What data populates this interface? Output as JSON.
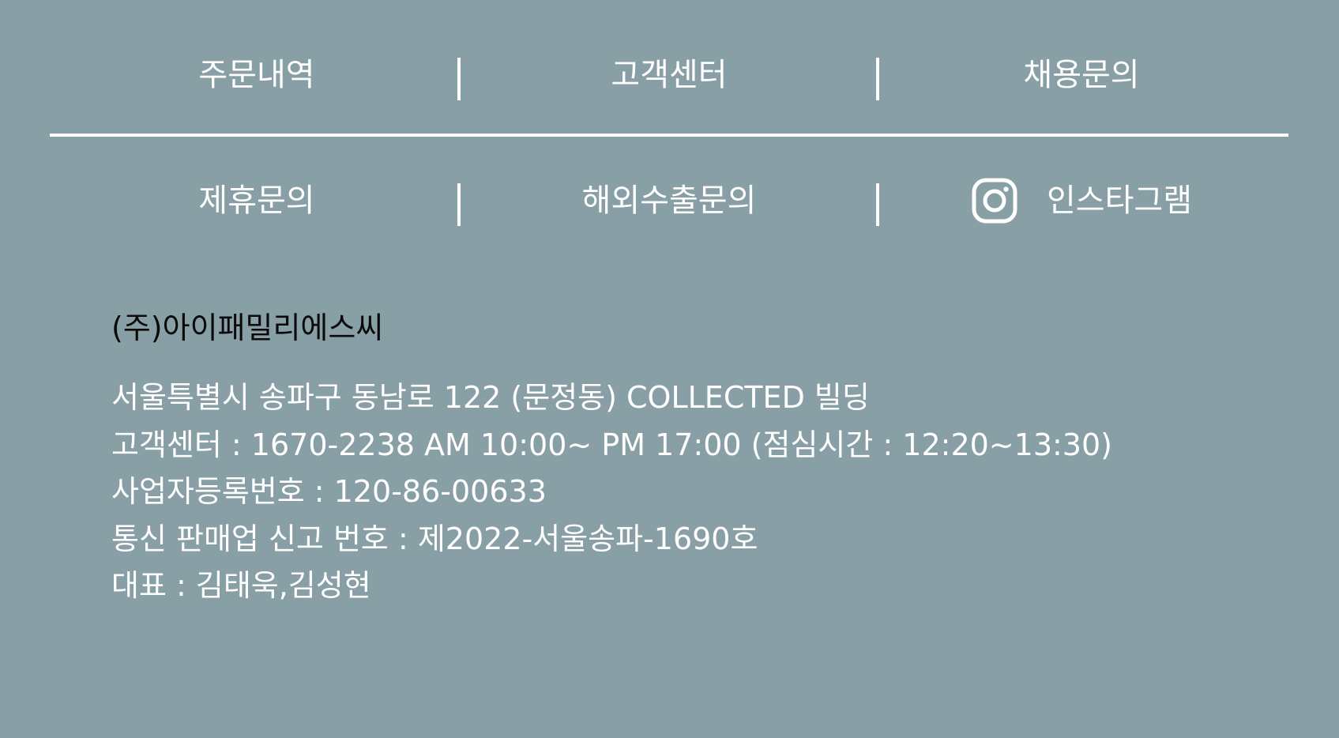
{
  "nav": {
    "row1": [
      {
        "label": "주문내역"
      },
      {
        "label": "고객센터"
      },
      {
        "label": "채용문의"
      }
    ],
    "row2": [
      {
        "label": "제휴문의"
      },
      {
        "label": "해외수출문의"
      },
      {
        "label": "인스타그램",
        "icon": "instagram-icon"
      }
    ]
  },
  "company": {
    "name": "(주)아이패밀리에스씨",
    "address": "서울특별시 송파구 동남로 122 (문정동) COLLECTED 빌딩",
    "customer_center": "고객센터 : 1670-2238 AM 10:00~ PM 17:00 (점심시간 : 12:20~13:30)",
    "business_number": "사업자등록번호 : 120-86-00633",
    "mail_order_number": "통신 판매업 신고 번호 : 제2022-서울송파-1690호",
    "representative": "대표 : 김태욱,김성현"
  },
  "colors": {
    "background": "#889fa5",
    "text": "#ffffff",
    "company_name": "#0a0a0a"
  }
}
